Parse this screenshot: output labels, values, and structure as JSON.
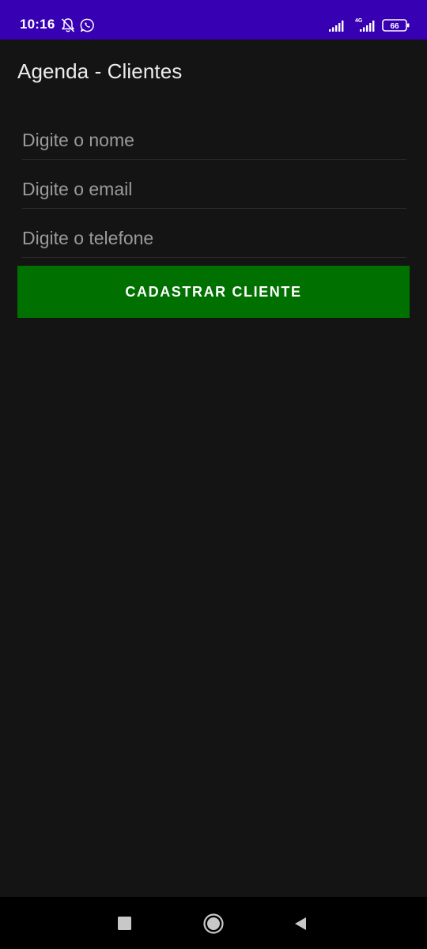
{
  "status_bar": {
    "time": "10:16",
    "battery": "66",
    "network": "4G",
    "icons": [
      "bell-off-icon",
      "whatsapp-icon",
      "signal-icon",
      "signal-4g-icon",
      "battery-icon"
    ],
    "background": "#3700b3"
  },
  "app_bar": {
    "title": "Agenda - Clientes"
  },
  "form": {
    "nome_placeholder": "Digite o nome",
    "nome_value": "",
    "email_placeholder": "Digite o email",
    "email_value": "",
    "telefone_placeholder": "Digite o telefone",
    "telefone_value": "",
    "submit_label": "CADASTRAR CLIENTE",
    "submit_color": "#007000"
  },
  "nav_bar": {
    "icons": [
      "recents-square-icon",
      "home-circle-icon",
      "back-triangle-icon"
    ]
  }
}
